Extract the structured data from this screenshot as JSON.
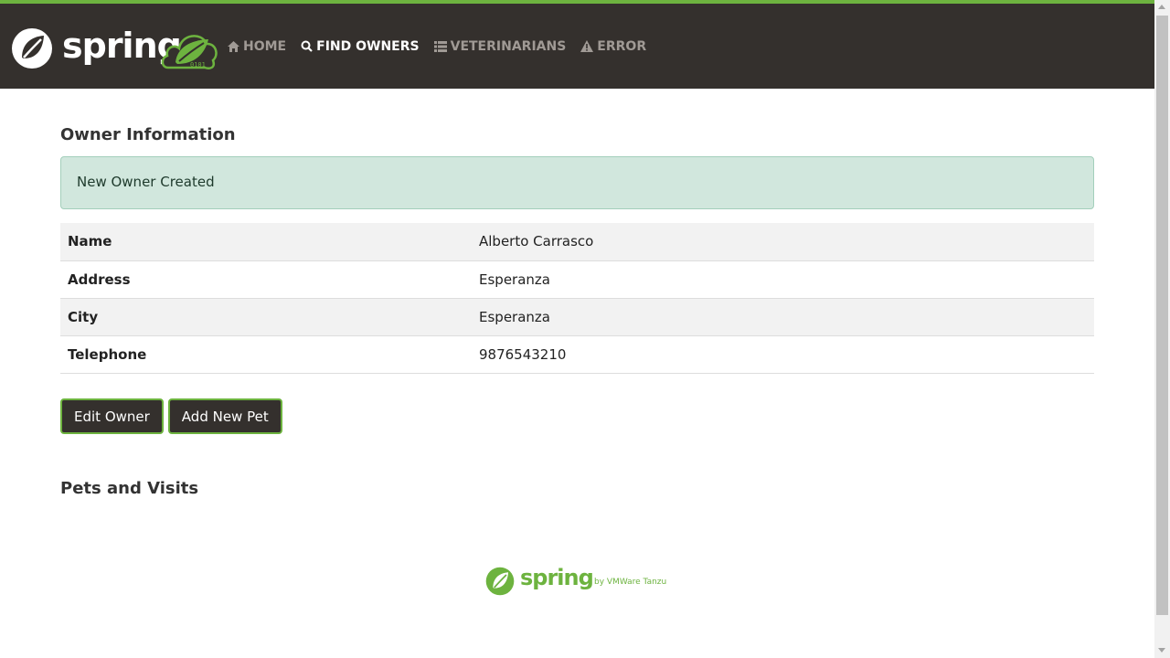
{
  "brand": {
    "logo_text": "spring",
    "badge_text": "0101"
  },
  "nav": {
    "items": [
      {
        "label": "HOME",
        "icon": "home-icon"
      },
      {
        "label": "FIND OWNERS",
        "icon": "search-icon",
        "active": true
      },
      {
        "label": "VETERINARIANS",
        "icon": "list-icon"
      },
      {
        "label": "ERROR",
        "icon": "warning-icon"
      }
    ]
  },
  "owner": {
    "title": "Owner Information",
    "alert": "New Owner Created",
    "rows": [
      {
        "label": "Name",
        "value": "Alberto Carrasco"
      },
      {
        "label": "Address",
        "value": "Esperanza"
      },
      {
        "label": "City",
        "value": "Esperanza"
      },
      {
        "label": "Telephone",
        "value": "9876543210"
      }
    ]
  },
  "actions": {
    "edit_label": "Edit Owner",
    "add_pet_label": "Add New Pet"
  },
  "pets": {
    "title": "Pets and Visits"
  },
  "footer": {
    "logo_text": "spring",
    "by_text": "by VMWare Tanzu"
  },
  "colors": {
    "brand_green": "#6db33f",
    "navbar_bg": "#34302d",
    "alert_bg": "#d1e7dd"
  }
}
